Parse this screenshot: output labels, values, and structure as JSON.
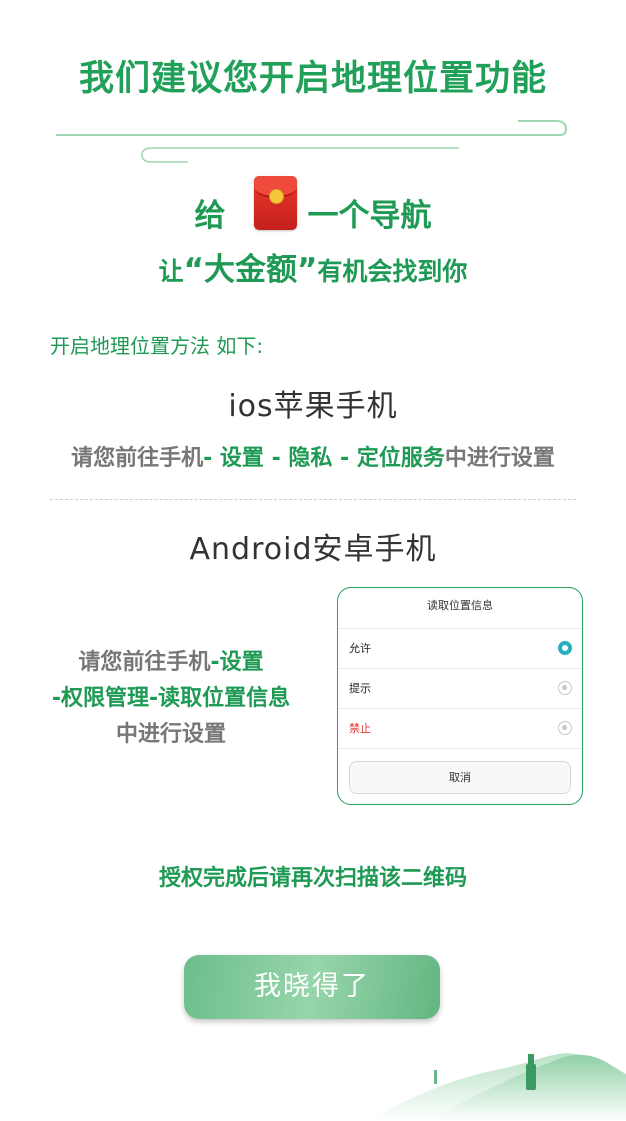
{
  "title": "我们建议您开启地理位置功能",
  "promo": {
    "line1_left": "给",
    "line1_icon": "red-envelope-icon",
    "line1_right": "一个导航",
    "line2_prefix": "让",
    "line2_highlight": "“大金额”",
    "line2_suffix": "有机会找到你"
  },
  "method_label": "开启地理位置方法 如下:",
  "ios": {
    "title": "ios苹果手机",
    "instr_prefix": "请您前往手机",
    "instr_path": "- 设置 - 隐私 - 定位服务",
    "instr_suffix": "中进行设置"
  },
  "android": {
    "title": "Android安卓手机",
    "instr_line1_prefix": "请您前往手机",
    "instr_line1_path": "-设置",
    "instr_line2": "-权限管理-读取位置信息",
    "instr_line3": "中进行设置"
  },
  "dialog": {
    "title": "读取位置信息",
    "options": [
      {
        "label": "允许",
        "selected": true
      },
      {
        "label": "提示",
        "selected": false
      },
      {
        "label": "禁止",
        "selected": false
      }
    ],
    "cancel": "取消"
  },
  "auth_note": "授权完成后请再次扫描该二维码",
  "confirm_button": "我晓得了",
  "colors": {
    "primary_green": "#1f9a55",
    "title_green": "#21a05a",
    "deny_red": "#e33b2e",
    "radio_selected": "#29aebe",
    "envelope_red": "#d62a22"
  }
}
